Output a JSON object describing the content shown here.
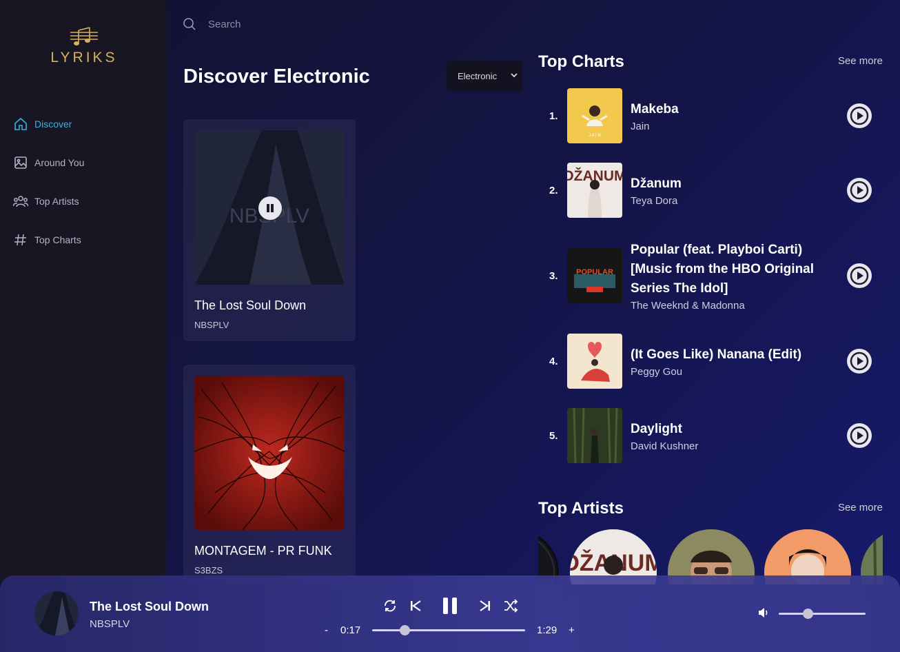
{
  "brand": {
    "name": "LYRIKS"
  },
  "sidebar": {
    "items": [
      {
        "label": "Discover",
        "icon": "home-icon",
        "active": true
      },
      {
        "label": "Around You",
        "icon": "image-icon",
        "active": false
      },
      {
        "label": "Top Artists",
        "icon": "users-icon",
        "active": false
      },
      {
        "label": "Top Charts",
        "icon": "hashtag-icon",
        "active": false
      }
    ]
  },
  "search": {
    "placeholder": "Search"
  },
  "discover": {
    "title": "Discover Electronic",
    "genre_selected": "Electronic",
    "songs": [
      {
        "title": "The Lost Soul Down",
        "artist": "NBSPLV",
        "art_text": "NBSPLV",
        "playing": true
      },
      {
        "title": "MONTAGEM - PR FUNK",
        "artist": "S3BZS"
      }
    ]
  },
  "top_charts": {
    "title": "Top Charts",
    "see_more": "See more",
    "items": [
      {
        "rank": "1.",
        "title": "Makeba",
        "artist": "Jain",
        "cover_text": "J A I N"
      },
      {
        "rank": "2.",
        "title": "Džanum",
        "artist": "Teya Dora",
        "cover_text": "DŽANUM"
      },
      {
        "rank": "3.",
        "title": "Popular (feat. Playboi Carti) [Music from the HBO Original Series The Idol]",
        "artist": "The Weeknd & Madonna",
        "cover_text": "POPULAR"
      },
      {
        "rank": "4.",
        "title": "(It Goes Like) Nanana (Edit)",
        "artist": "Peggy Gou"
      },
      {
        "rank": "5.",
        "title": "Daylight",
        "artist": "David Kushner"
      }
    ]
  },
  "top_artists": {
    "title": "Top Artists",
    "see_more": "See more"
  },
  "player": {
    "title": "The Lost Soul Down",
    "artist": "NBSPLV",
    "minus": "-",
    "plus": "+",
    "current_time": "0:17",
    "duration": "1:29",
    "progress_percent": 21,
    "volume_percent": 33
  },
  "colors": {
    "accent": "#33b3e6",
    "gold": "#d7b25a"
  }
}
